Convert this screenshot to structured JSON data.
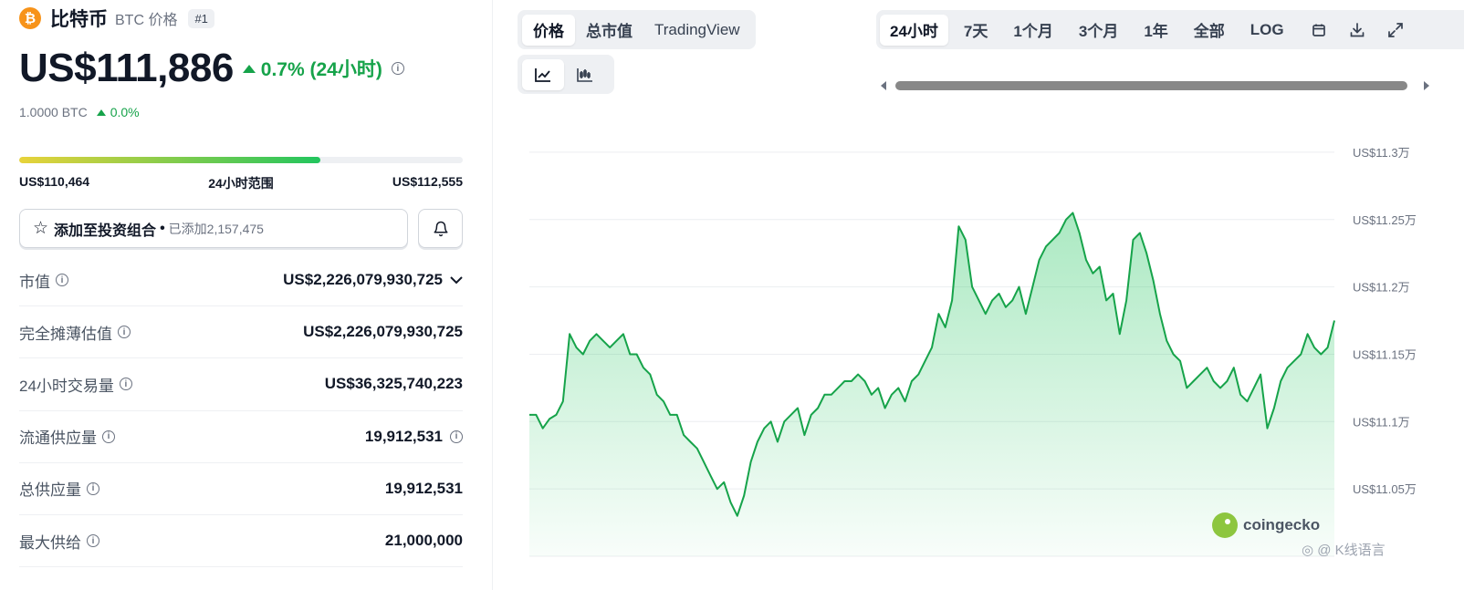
{
  "coin": {
    "logo_symbol": "₿",
    "name": "比特币",
    "symbol_label": "BTC 价格",
    "rank": "#1",
    "price": "US$111,886",
    "change_24h": "0.7% (24小时)",
    "btc_value": "1.0000 BTC",
    "btc_change": "0.0%"
  },
  "range": {
    "low": "US$110,464",
    "label": "24小时范围",
    "high": "US$112,555",
    "fill_fraction": 0.68
  },
  "portfolio": {
    "button_label": "添加至投资组合",
    "separator": "•",
    "added_text": "已添加2,157,475"
  },
  "stats": [
    {
      "label": "市值",
      "value": "US$2,226,079,930,725",
      "trailing": "chevron"
    },
    {
      "label": "完全摊薄估值",
      "value": "US$2,226,079,930,725",
      "trailing": ""
    },
    {
      "label": "24小时交易量",
      "value": "US$36,325,740,223",
      "trailing": ""
    },
    {
      "label": "流通供应量",
      "value": "19,912,531",
      "trailing": "info"
    },
    {
      "label": "总供应量",
      "value": "19,912,531",
      "trailing": ""
    },
    {
      "label": "最大供给",
      "value": "21,000,000",
      "trailing": ""
    }
  ],
  "view_tabs": [
    "价格",
    "总市值",
    "TradingView"
  ],
  "active_view_tab": 0,
  "period_tabs": [
    "24小时",
    "7天",
    "1个月",
    "3个月",
    "1年",
    "全部",
    "LOG"
  ],
  "active_period_tab": 0,
  "icons": [
    "star-icon",
    "bell-icon",
    "info-icon",
    "chevron-down-icon",
    "line-chart-icon",
    "candlestick-icon",
    "calendar-icon",
    "download-icon",
    "expand-icon"
  ],
  "colors": {
    "up": "#16a34a",
    "line": "#16a34a",
    "fill": "#22c55e",
    "bitcoin": "#f7931a",
    "brand_gecko": "#8dc63f"
  },
  "watermark": "coingecko",
  "corner_text": "◎ @ K线语言",
  "chart_data": {
    "type": "area",
    "title": "",
    "xlabel": "",
    "ylabel": "",
    "y_tick_labels": [
      "US$11.3万",
      "US$11.25万",
      "US$11.2万",
      "US$11.15万",
      "US$11.1万",
      "US$11.05万"
    ],
    "y_ticks": [
      113000,
      112500,
      112000,
      111500,
      111000,
      110500
    ],
    "ylim": [
      110000,
      113250
    ],
    "grid": true,
    "series": [
      {
        "values": [
          111050,
          111050,
          110950,
          111020,
          111050,
          111150,
          111650,
          111550,
          111500,
          111600,
          111650,
          111600,
          111550,
          111600,
          111650,
          111500,
          111500,
          111400,
          111350,
          111200,
          111150,
          111050,
          111050,
          110900,
          110850,
          110800,
          110700,
          110600,
          110500,
          110550,
          110400,
          110300,
          110450,
          110700,
          110850,
          110950,
          111000,
          110850,
          111000,
          111050,
          111100,
          110900,
          111050,
          111100,
          111200,
          111200,
          111250,
          111300,
          111300,
          111350,
          111300,
          111200,
          111250,
          111100,
          111200,
          111250,
          111150,
          111300,
          111350,
          111450,
          111550,
          111800,
          111700,
          111900,
          112450,
          112350,
          112000,
          111900,
          111800,
          111900,
          111950,
          111850,
          111900,
          112000,
          111800,
          112000,
          112200,
          112300,
          112350,
          112400,
          112500,
          112550,
          112400,
          112200,
          112100,
          112150,
          111900,
          111950,
          111650,
          111900,
          112350,
          112400,
          112250,
          112050,
          111800,
          111600,
          111500,
          111450,
          111250,
          111300,
          111350,
          111400,
          111300,
          111250,
          111300,
          111400,
          111200,
          111150,
          111250,
          111350,
          110950,
          111100,
          111300,
          111400,
          111450,
          111500,
          111650,
          111550,
          111500,
          111550,
          111750
        ]
      }
    ]
  }
}
